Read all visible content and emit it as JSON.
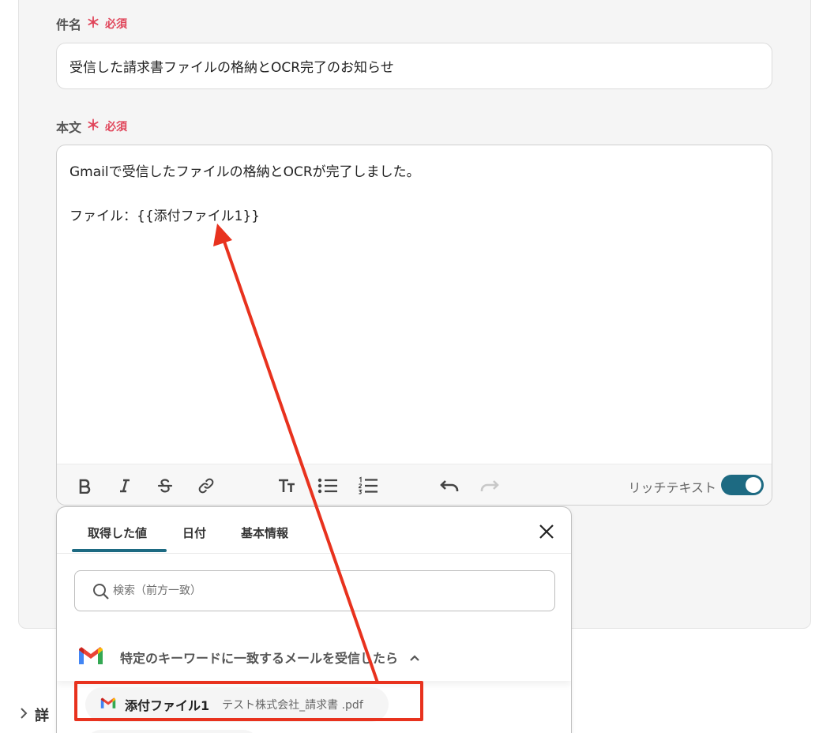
{
  "subject": {
    "label": "件名",
    "required_mark": "＊",
    "required_text": "必須",
    "value": "受信した請求書ファイルの格納とOCR完了のお知らせ"
  },
  "body": {
    "label": "本文",
    "required_mark": "＊",
    "required_text": "必須",
    "lines": [
      "Gmailで受信したファイルの格納とOCRが完了しました。",
      "",
      "ファイル：{{添付ファイル1}}"
    ]
  },
  "toolbar": {
    "icons": [
      "bold-icon",
      "italic-icon",
      "strikethrough-icon",
      "link-icon",
      "text-size-icon",
      "bullet-list-icon",
      "numbered-list-icon",
      "undo-icon",
      "redo-icon"
    ],
    "rich_text_label": "リッチテキスト",
    "rich_text_enabled": true
  },
  "popup": {
    "tabs": [
      {
        "label": "取得した値",
        "active": true
      },
      {
        "label": "日付",
        "active": false
      },
      {
        "label": "基本情報",
        "active": false
      }
    ],
    "search_placeholder": "検索（前方一致）",
    "section_title": "特定のキーワードに一致するメールを受信したら",
    "result": {
      "label": "添付ファイル1",
      "value": "テスト株式会社_請求書 .pdf"
    }
  },
  "details_label": "詳",
  "colors": {
    "accent": "#1d6a82",
    "required": "#e0455a",
    "annotation": "#e8321e"
  }
}
